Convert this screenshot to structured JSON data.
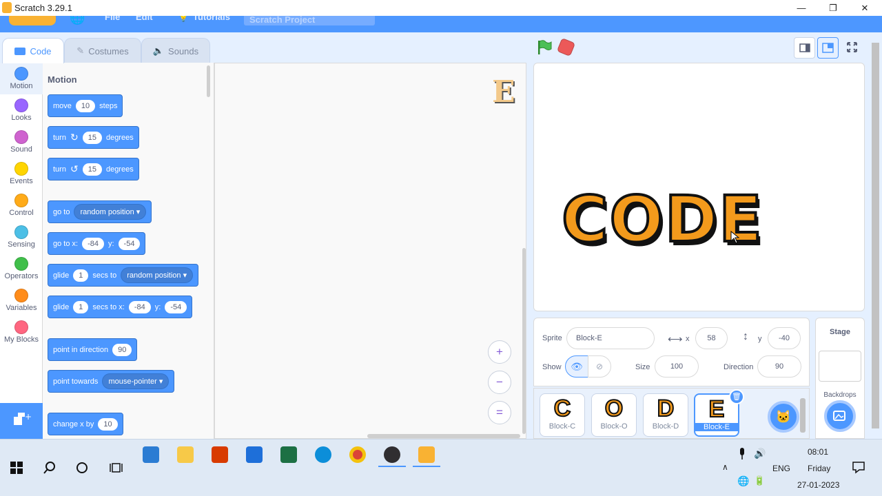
{
  "window": {
    "title": "Scratch 3.29.1",
    "controls": [
      "—",
      "❐",
      "✕"
    ]
  },
  "menubar": {
    "logo": "Scratch",
    "items": [
      "File",
      "Edit",
      "Tutorials"
    ],
    "project_title": "Scratch Project"
  },
  "tabs": [
    {
      "label": "Code",
      "icon": "code-icon"
    },
    {
      "label": "Costumes",
      "icon": "brush-icon"
    },
    {
      "label": "Sounds",
      "icon": "speaker-icon"
    }
  ],
  "categories": [
    {
      "label": "Motion",
      "color": "#4c97ff"
    },
    {
      "label": "Looks",
      "color": "#9966ff"
    },
    {
      "label": "Sound",
      "color": "#cf63cf"
    },
    {
      "label": "Events",
      "color": "#ffd500"
    },
    {
      "label": "Control",
      "color": "#ffab19"
    },
    {
      "label": "Sensing",
      "color": "#4cbfe6"
    },
    {
      "label": "Operators",
      "color": "#40bf4a"
    },
    {
      "label": "Variables",
      "color": "#ff8c1a"
    },
    {
      "label": "My Blocks",
      "color": "#ff6680"
    }
  ],
  "palette": {
    "heading": "Motion",
    "blocks": {
      "move": {
        "a": "move",
        "v": "10",
        "b": "steps"
      },
      "turn_right": {
        "a": "turn",
        "v": "15",
        "b": "degrees"
      },
      "turn_left": {
        "a": "turn",
        "v": "15",
        "b": "degrees"
      },
      "goto": {
        "a": "go to",
        "dd": "random position"
      },
      "gotoxy": {
        "a": "go to x:",
        "x": "-84",
        "ylabel": "y:",
        "y": "-54"
      },
      "glide": {
        "a": "glide",
        "v": "1",
        "b": "secs to",
        "dd": "random position"
      },
      "glidexy": {
        "a": "glide",
        "v": "1",
        "b": "secs to x:",
        "x": "-84",
        "ylabel": "y:",
        "y": "-54"
      },
      "point_dir": {
        "a": "point in direction",
        "v": "90"
      },
      "point_towards": {
        "a": "point towards",
        "dd": "mouse-pointer"
      },
      "change_x": {
        "a": "change x by",
        "v": "10"
      }
    }
  },
  "script_area": {
    "sprite_letter": "E",
    "zoom_buttons": [
      "+",
      "−",
      "="
    ]
  },
  "stage": {
    "text": "CODE"
  },
  "sprite_info": {
    "sprite_label": "Sprite",
    "sprite_name": "Block-E",
    "x_label": "x",
    "x": "58",
    "y_label": "y",
    "y": "-40",
    "show_label": "Show",
    "size_label": "Size",
    "size": "100",
    "direction_label": "Direction",
    "direction": "90"
  },
  "sprites": [
    {
      "glyph": "C",
      "name": "Block-C"
    },
    {
      "glyph": "O",
      "name": "Block-O"
    },
    {
      "glyph": "D",
      "name": "Block-D"
    },
    {
      "glyph": "E",
      "name": "Block-E"
    }
  ],
  "stage_panel": {
    "title": "Stage",
    "backdrops_label": "Backdrops"
  },
  "taskbar": {
    "lang": "ENG",
    "time": "08:01",
    "day": "Friday",
    "date": "27-01-2023",
    "apps": [
      "mail-icon",
      "file-explorer-icon",
      "office-icon",
      "store-icon",
      "excel-icon",
      "edge-icon",
      "chrome-icon",
      "obs-icon",
      "scratch-icon"
    ]
  }
}
